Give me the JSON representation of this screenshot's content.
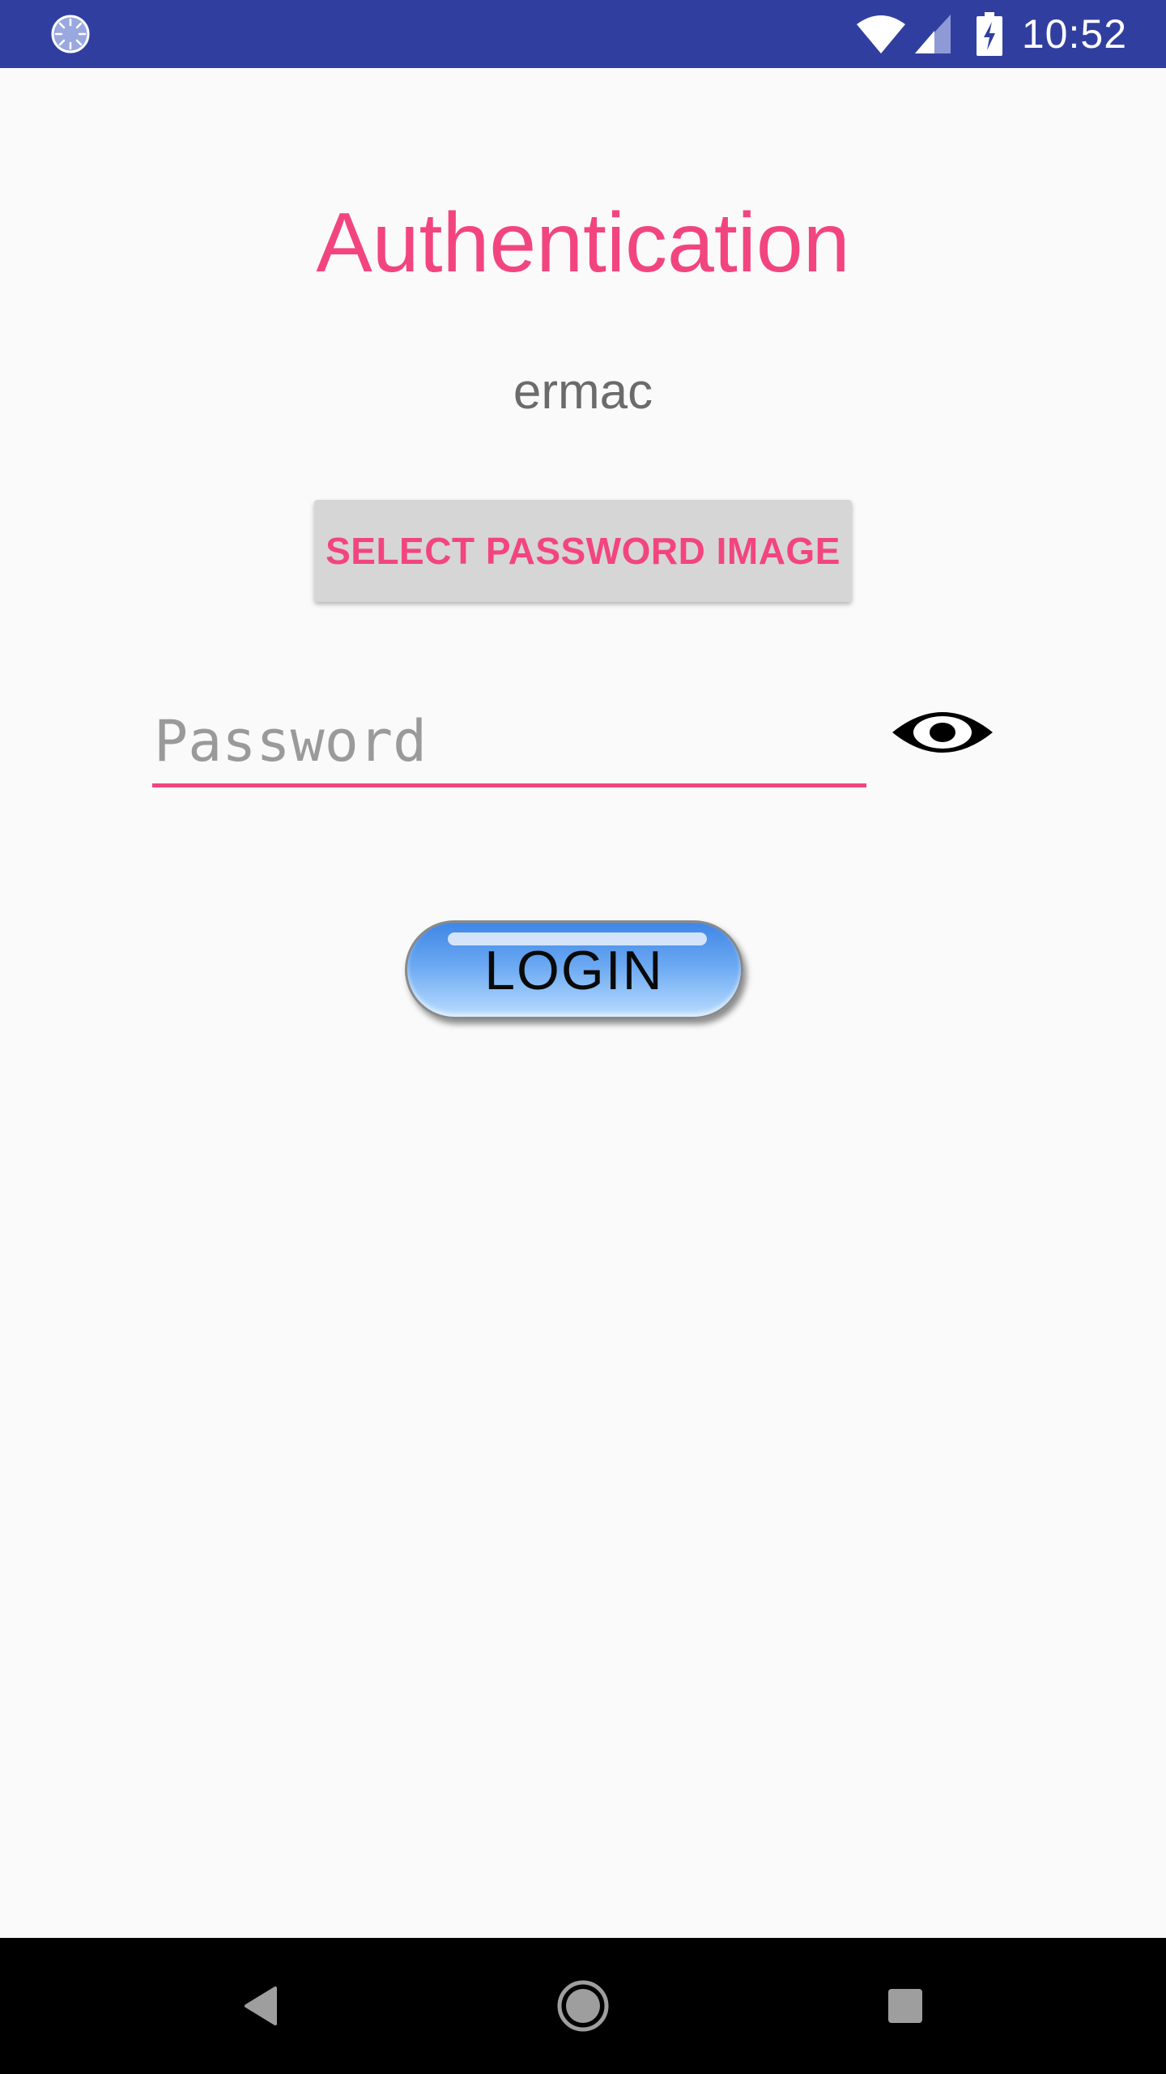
{
  "status_bar": {
    "time": "10:52",
    "left_icon": "loading-spinner-icon",
    "icons": [
      "wifi-icon",
      "signal-icon",
      "battery-charging-icon"
    ],
    "background_color": "#303f9f"
  },
  "screen": {
    "title": "Authentication",
    "username": "ermac",
    "select_image_button_label": "SELECT PASSWORD IMAGE",
    "password_placeholder": "Password",
    "password_value": "",
    "show_password_icon": "eye-icon",
    "login_label": "LOGIN",
    "accent_color": "#f2457f"
  },
  "nav_bar": {
    "buttons": [
      "back-icon",
      "home-icon",
      "recents-icon"
    ]
  }
}
